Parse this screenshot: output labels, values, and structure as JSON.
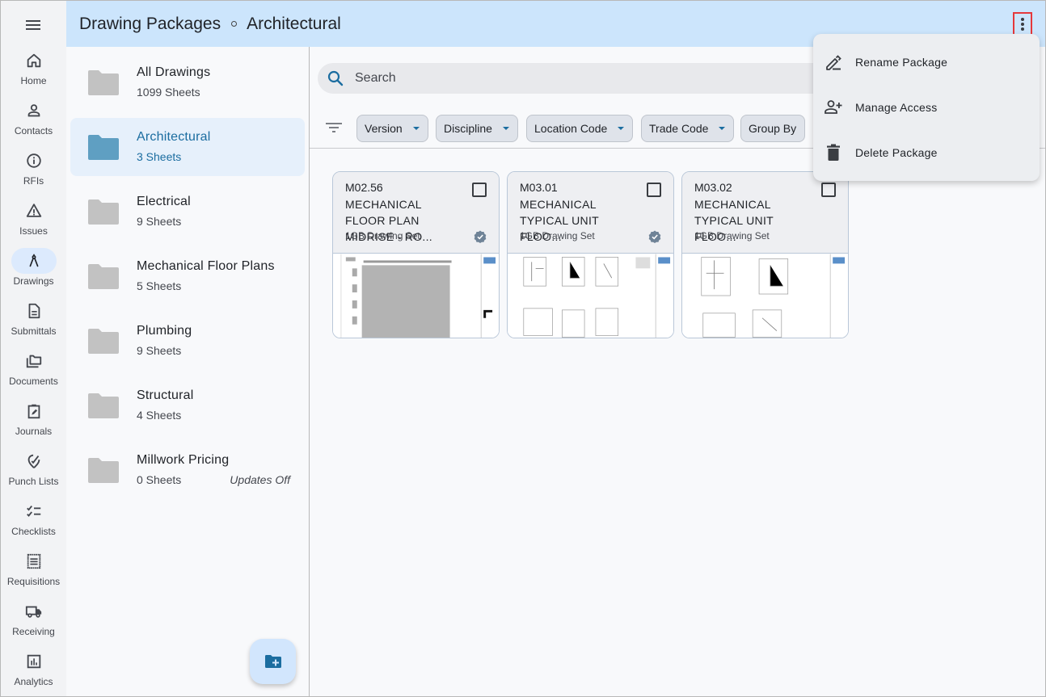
{
  "header": {
    "title": "Drawing Packages",
    "subtitle": "Architectural"
  },
  "rail": {
    "items": [
      {
        "label": "Home",
        "icon": "home-icon"
      },
      {
        "label": "Contacts",
        "icon": "person-icon"
      },
      {
        "label": "RFIs",
        "icon": "info-icon"
      },
      {
        "label": "Issues",
        "icon": "warning-icon"
      },
      {
        "label": "Drawings",
        "icon": "compass-icon",
        "active": true
      },
      {
        "label": "Submittals",
        "icon": "document-icon"
      },
      {
        "label": "Documents",
        "icon": "folders-icon"
      },
      {
        "label": "Journals",
        "icon": "clipboard-edit-icon"
      },
      {
        "label": "Punch Lists",
        "icon": "punch-icon"
      },
      {
        "label": "Checklists",
        "icon": "checklist-icon"
      },
      {
        "label": "Requisitions",
        "icon": "receipt-icon"
      },
      {
        "label": "Receiving",
        "icon": "truck-icon"
      },
      {
        "label": "Analytics",
        "icon": "bar-chart-icon"
      }
    ]
  },
  "packages": [
    {
      "name": "All Drawings",
      "count": "1099 Sheets"
    },
    {
      "name": "Architectural",
      "count": "3 Sheets",
      "active": true
    },
    {
      "name": "Electrical",
      "count": "9 Sheets"
    },
    {
      "name": "Mechanical Floor Plans",
      "count": "5 Sheets"
    },
    {
      "name": "Plumbing",
      "count": "9 Sheets"
    },
    {
      "name": "Structural",
      "count": "4 Sheets"
    },
    {
      "name": "Millwork Pricing",
      "count": "0 Sheets",
      "note": "Updates Off"
    }
  ],
  "search": {
    "placeholder": "Search",
    "value": ""
  },
  "filters": [
    {
      "label": "Version",
      "dropdown": true
    },
    {
      "label": "Discipline",
      "dropdown": true
    },
    {
      "label": "Location Code",
      "dropdown": true
    },
    {
      "label": "Trade Code",
      "dropdown": true
    },
    {
      "label": "Group By",
      "dropdown": false
    }
  ],
  "sheets": [
    {
      "code": "M02.56",
      "title": "MECHANICAL FLOOR PLAN MIDRISE - RO...",
      "set": "1GB Drawing Set",
      "verified": true,
      "checked": false
    },
    {
      "code": "M03.01",
      "title": "MECHANICAL TYPICAL UNIT FLOO...",
      "set": "1GB Drawing Set",
      "verified": true,
      "checked": false
    },
    {
      "code": "M03.02",
      "title": "MECHANICAL TYPICAL UNIT FLOO...",
      "set": "1GB Drawing Set",
      "verified": false,
      "checked": false
    }
  ],
  "menu": {
    "items": [
      {
        "label": "Rename Package",
        "icon": "pencil-icon"
      },
      {
        "label": "Manage Access",
        "icon": "person-add-icon"
      },
      {
        "label": "Delete Package",
        "icon": "trash-icon"
      }
    ]
  },
  "colors": {
    "header_bg": "#cce5fc",
    "accent": "#1b6da0",
    "active_item_bg": "#e6f0fb",
    "annotation_red": "#e5383b"
  }
}
